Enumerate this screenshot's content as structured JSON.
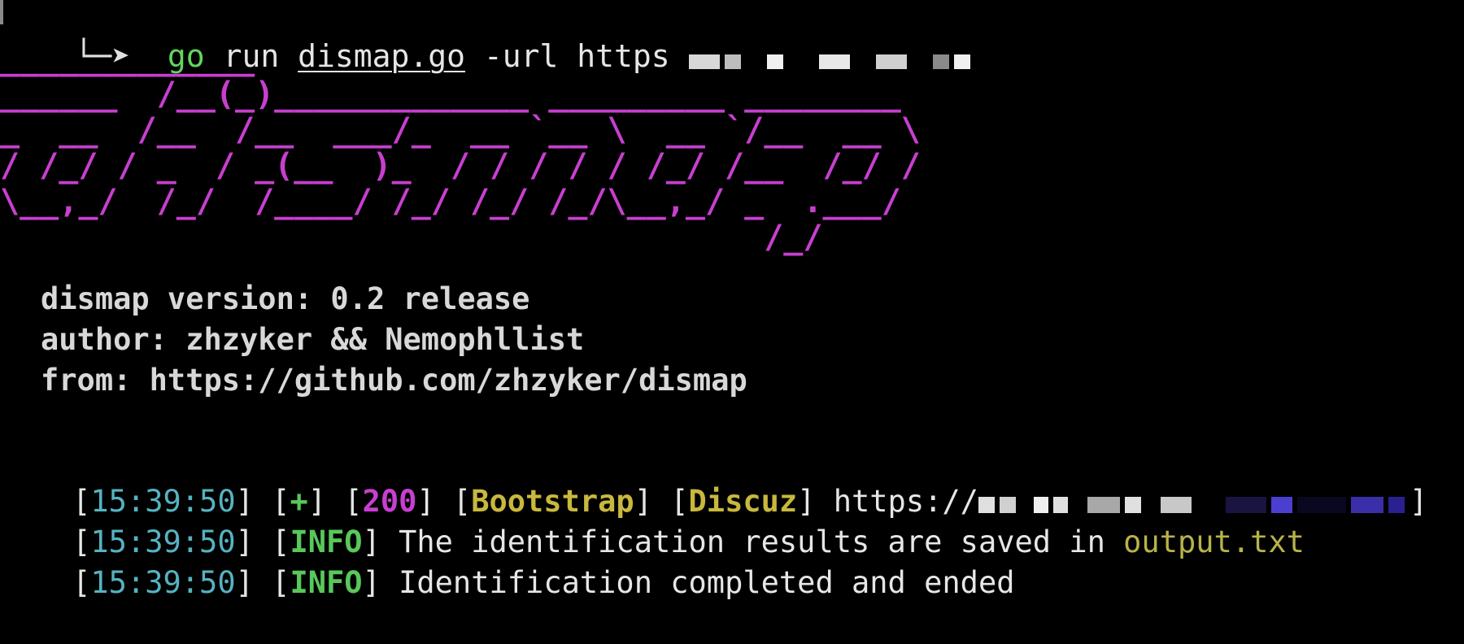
{
  "prompt": {
    "arrow": "└─➤",
    "cmd_go": "go",
    "cmd_run": "run",
    "cmd_file": "dismap.go",
    "cmd_args": "-url https"
  },
  "banner": {
    "lines": [
      "_____________",
      "______  /__(_)_____________ _________ ________",
      "_  __  /__  /__  ___/_  __ `__ \\  __ `/__  __ \\",
      "/ /_/ / _  / _(__  )_  / / / / / /_/ /__  /_/ /",
      "\\__,_/  /_/  /____/ /_/ /_/ /_/\\__,_/ _  .___/",
      "                                       /_/"
    ]
  },
  "info": {
    "version": "dismap version: 0.2 release",
    "author": "author: zhzyker && Nemophllist",
    "from": "from: https://github.com/zhzyker/dismap"
  },
  "logs": [
    {
      "time": "15:39:50",
      "level": "+",
      "status": "200",
      "tags": [
        "Bootstrap",
        "Discuz"
      ],
      "text": "https://"
    },
    {
      "time": "15:39:50",
      "level": "INFO",
      "text": "The identification results are saved in ",
      "file": "output.txt"
    },
    {
      "time": "15:39:50",
      "level": "INFO",
      "text": "Identification completed and ended"
    }
  ],
  "colors": {
    "background": "#000000",
    "banner": "#c83fd0",
    "timestamp": "#55b3c2",
    "ok": "#58c85a",
    "tag": "#c8b83d"
  }
}
